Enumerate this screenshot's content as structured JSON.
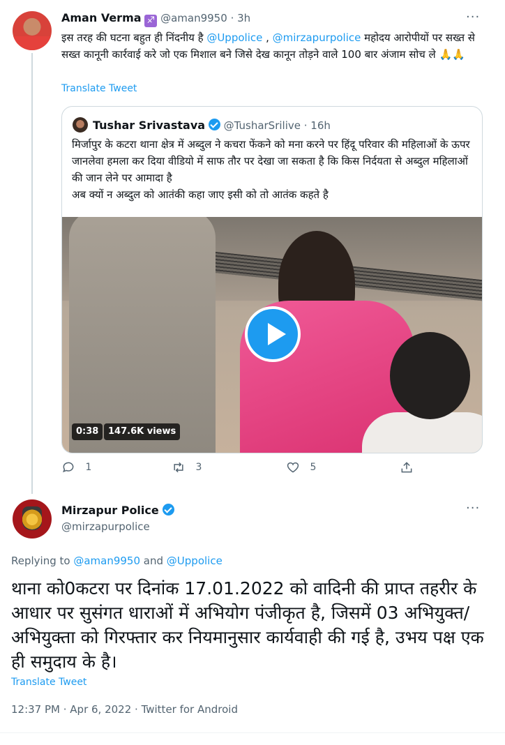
{
  "tweet1": {
    "name": "Aman Verma",
    "badge_glyph": "♐",
    "handle": "@aman9950",
    "time": "· 3h",
    "text_before": "इस तरह की घटना बहुत ही निंदनीय है ",
    "mention1": "@Uppolice",
    "separator": " , ",
    "mention2": "@mirzapurpolice",
    "text_after": "  महोदय आरोपीयों पर सख्त से सख्त कानूनी कार्रवाई करे जो एक मिशाल बने जिसे देख कानून तोड़ने वाले 100 बार अंजाम सोच ले 🙏🙏",
    "translate": "Translate Tweet",
    "more": "···",
    "quote": {
      "name": "Tushar Srivastava",
      "handle": "@TusharSrilive",
      "time": "· 16h",
      "text": "मिर्जापुर के कटरा थाना क्षेत्र में अब्दुल ने कचरा फेंकने को मना करने पर हिंदू परिवार की महिलाओं के ऊपर जानलेवा हमला कर दिया वीडियो में साफ तौर पर देखा जा सकता है कि किस निर्दयता से अब्दुल महिलाओं की जान लेने पर आमादा है",
      "text2": "अब क्यों न अब्दुल को आतंकी कहा जाए इसी को तो आतंक कहते है",
      "video_duration": "0:38",
      "video_views": "147.6K views"
    },
    "actions": {
      "replies": "1",
      "retweets": "3",
      "likes": "5"
    }
  },
  "tweet2": {
    "name": "Mirzapur Police",
    "handle": "@mirzapurpolice",
    "more": "···",
    "replying_prefix": "Replying to ",
    "replying_to1": "@aman9950",
    "replying_and": " and ",
    "replying_to2": "@Uppolice",
    "text": "थाना को0कटरा पर दिनांक 17.01.2022 को वादिनी की प्राप्त तहरीर के आधार पर सुसंगत धाराओं में अभियोग पंजीकृत है, जिसमें 03 अभियुक्त/अभियुक्ता को गिरफ्तार कर नियमानुसार कार्यवाही की गई है, उभय पक्ष एक ही समुदाय के है।",
    "translate": "Translate Tweet",
    "meta": "12:37 PM · Apr 6, 2022 · Twitter for Android"
  },
  "colors": {
    "accent": "#1d9bf0",
    "muted": "#536471",
    "border": "#cfd9de"
  }
}
